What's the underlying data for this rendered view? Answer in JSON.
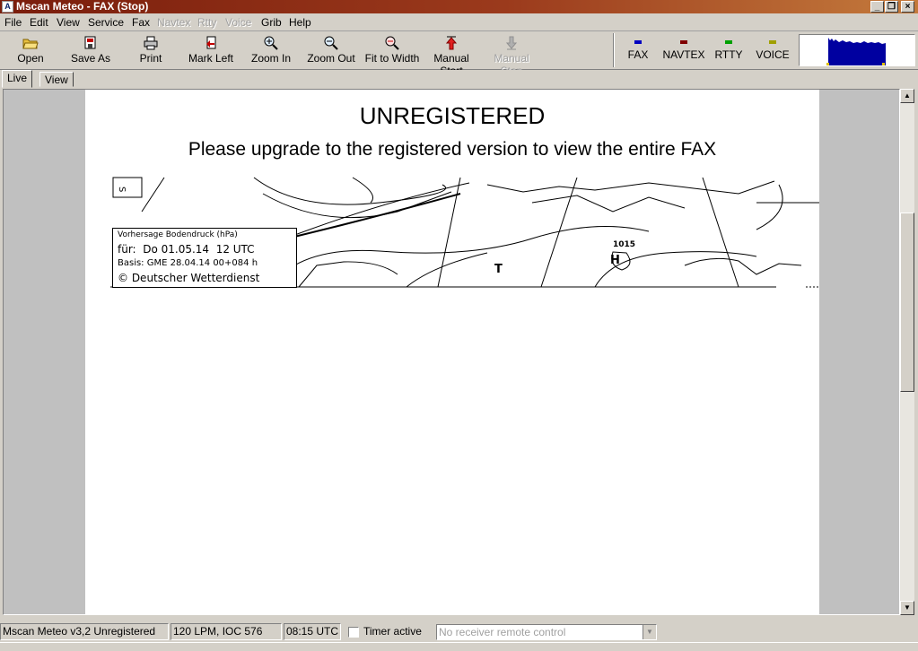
{
  "window": {
    "title": "Mscan Meteo - FAX (Stop)"
  },
  "menu": [
    "File",
    "Edit",
    "View",
    "Service",
    "Fax",
    "Navtex",
    "Rtty",
    "Voice",
    "Grib",
    "Help"
  ],
  "toolbar": {
    "open": "Open",
    "save_as": "Save As",
    "print": "Print",
    "mark_left": "Mark Left",
    "zoom_in": "Zoom In",
    "zoom_out": "Zoom Out",
    "fit_to_width": "Fit to Width",
    "manual_start": "Manual Start",
    "manual_stop": "Manual Stop"
  },
  "modes": {
    "fax": {
      "label": "FAX",
      "color": "#0000c0"
    },
    "navtex": {
      "label": "NAVTEX",
      "color": "#800000"
    },
    "rtty": {
      "label": "RTTY",
      "color": "#00a000"
    },
    "voice": {
      "label": "VOICE",
      "color": "#a0a000"
    }
  },
  "tabs": {
    "live": "Live",
    "view": "View"
  },
  "fax": {
    "unregistered": "UNREGISTERED",
    "upgrade_notice": "Please upgrade to the registered version to view the entire FAX",
    "legend_line1": "Vorhersage Bodendruck (hPa)",
    "legend_line2": "für:  Do 01.05.14  12 UTC",
    "legend_line3": "Basis: GME  28.04.14 00+084 h",
    "legend_line4": "© Deutscher Wetterdienst",
    "low_symbol": "T",
    "high_symbol": "H",
    "high_value": "1015"
  },
  "status": {
    "version": "Mscan Meteo v3,2 Unregistered",
    "lpm": "120 LPM, IOC 576",
    "time": "08:15 UTC",
    "timer_label": "Timer active",
    "receiver": "No receiver remote control"
  }
}
